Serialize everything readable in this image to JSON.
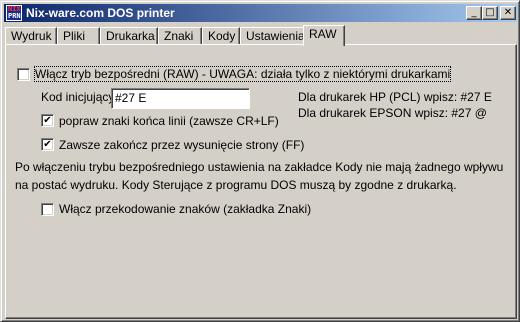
{
  "window": {
    "title": "Nix-ware.com DOS printer"
  },
  "app_icon": {
    "top": "NIX",
    "bottom": "PRN"
  },
  "title_buttons": {
    "minimize": "_",
    "maximize": "□",
    "close": "✕"
  },
  "tabs": [
    {
      "label": "Wydruk",
      "active": false
    },
    {
      "label": "Pliki",
      "active": false
    },
    {
      "label": "Drukarka",
      "active": false
    },
    {
      "label": "Znaki",
      "active": false
    },
    {
      "label": "Kody",
      "active": false
    },
    {
      "label": "Ustawienia",
      "active": false
    },
    {
      "label": "RAW",
      "active": true
    }
  ],
  "raw": {
    "enable_raw": {
      "label": "Włącz tryb bezpośredni (RAW) - UWAGA: działa tylko z niektórymi drukarkami",
      "checked": false
    },
    "init_code": {
      "label": "Kod inicjujący",
      "value": "#27 E"
    },
    "hint_hp": "Dla drukarek HP (PCL) wpisz: #27 E",
    "hint_epson": "Dla drukarek EPSON wpisz: #27 @",
    "fix_line_endings": {
      "label": "popraw znaki końca linii (zawsze CR+LF)",
      "checked": true
    },
    "form_feed": {
      "label": "Zawsze zakończ przez wysunięcie strony (FF)",
      "checked": true
    },
    "info_line1": "Po włączeniu trybu bezpośredniego ustawienia na zakładce Kody nie mają żadnego wpływu",
    "info_line2": "na postać wydruku. Kody Sterujące z programu DOS muszą by zgodne z drukarką.",
    "recode": {
      "label": "Włącz przekodowanie znaków (zakładka Znaki)",
      "checked": false
    },
    "check_glyph": "✔"
  }
}
